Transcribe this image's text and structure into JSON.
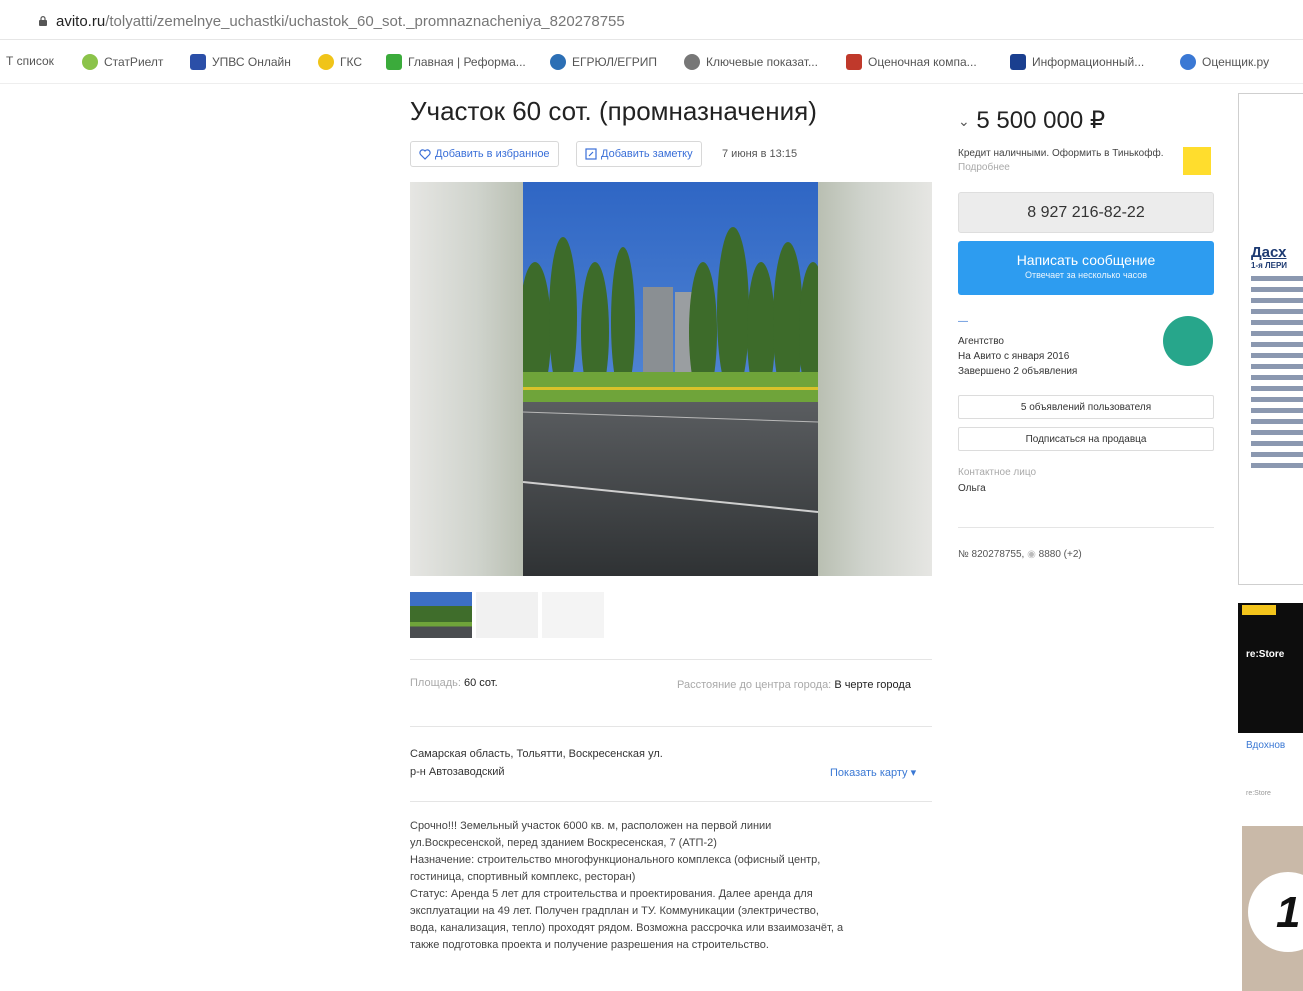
{
  "browser": {
    "url_host": "avito.ru",
    "url_path": "/tolyatti/zemelnye_uchastki/uchastok_60_sot._promnaznacheniya_820278755",
    "bookmarks": [
      {
        "label": "Т список",
        "color": "#ffffff"
      },
      {
        "label": "СтатРиелт",
        "color": "#8bc34a"
      },
      {
        "label": "УПВС Онлайн",
        "color": "#2b4fa8"
      },
      {
        "label": "ГКС",
        "color": "#f0c419"
      },
      {
        "label": "Главная | Реформа...",
        "color": "#3bab3b"
      },
      {
        "label": "ЕГРЮЛ/ЕГРИП",
        "color": "#2c6fb5"
      },
      {
        "label": "Ключевые показат...",
        "color": "#777777"
      },
      {
        "label": "Оценочная компа...",
        "color": "#c0392b"
      },
      {
        "label": "Информационный...",
        "color": "#1a3f8f"
      },
      {
        "label": "Оценщик.ру",
        "color": "#3a78d4"
      }
    ]
  },
  "listing": {
    "title": "Участок 60 сот. (промназначения)",
    "add_favorite": "Добавить в избранное",
    "add_note": "Добавить заметку",
    "date": "7 июня в 13:15",
    "params": {
      "area_label": "Площадь:",
      "area_value": "60 сот.",
      "distance_label": "Расстояние до центра города:",
      "distance_value": "В черте города"
    },
    "address_line": "Самарская область, Тольятти, Воскресенская ул.",
    "district": "р-н Автозаводский",
    "show_map": "Показать карту",
    "description": [
      "Срочно!!! Земельный участок 6000 кв. м, расположен на первой линии",
      "ул.Воскресенской, перед зданием Воскресенская, 7 (АТП-2)",
      "Назначение: строительство многофункционального комплекса (офисный центр,",
      "гостиница, спортивный комплекс, ресторан)",
      "Статус: Аренда 5 лет для строительства и проектирования. Далее аренда для",
      "эксплуатации на 49 лет. Получен градплан и ТУ. Коммуникации (электричество,",
      "вода, канализация, тепло) проходят рядом. Возможна рассрочка или взаимозачёт, а",
      "также подготовка проекта и получение разрешения на строительство."
    ]
  },
  "sidebar": {
    "price": "5 500 000 ₽",
    "credit_text": "Кредит наличными. Оформить в Тинькофф.",
    "credit_link": "Подробнее",
    "phone": "8 927 216-82-22",
    "message_button": "Написать сообщение",
    "message_sub": "Отвечает за несколько часов",
    "seller_name": "—",
    "seller_type": "Агентство",
    "seller_since": "На Авито с января 2016",
    "seller_completed": "Завершено 2 объявления",
    "user_ads": "5 объявлений пользователя",
    "subscribe": "Подписаться на продавца",
    "contact_label": "Контактное лицо",
    "contact_name": "Ольга",
    "ad_number": "№ 820278755,",
    "views": "8880 (+2)"
  },
  "ads": {
    "ad1_logo": "Дасх",
    "ad1_sub": "1-я ЛЕРИ",
    "ad2_label": "re:Store",
    "ad2_caption": "Вдохнов",
    "ad2_small": "re:Store",
    "ad3_glyph": "1"
  }
}
